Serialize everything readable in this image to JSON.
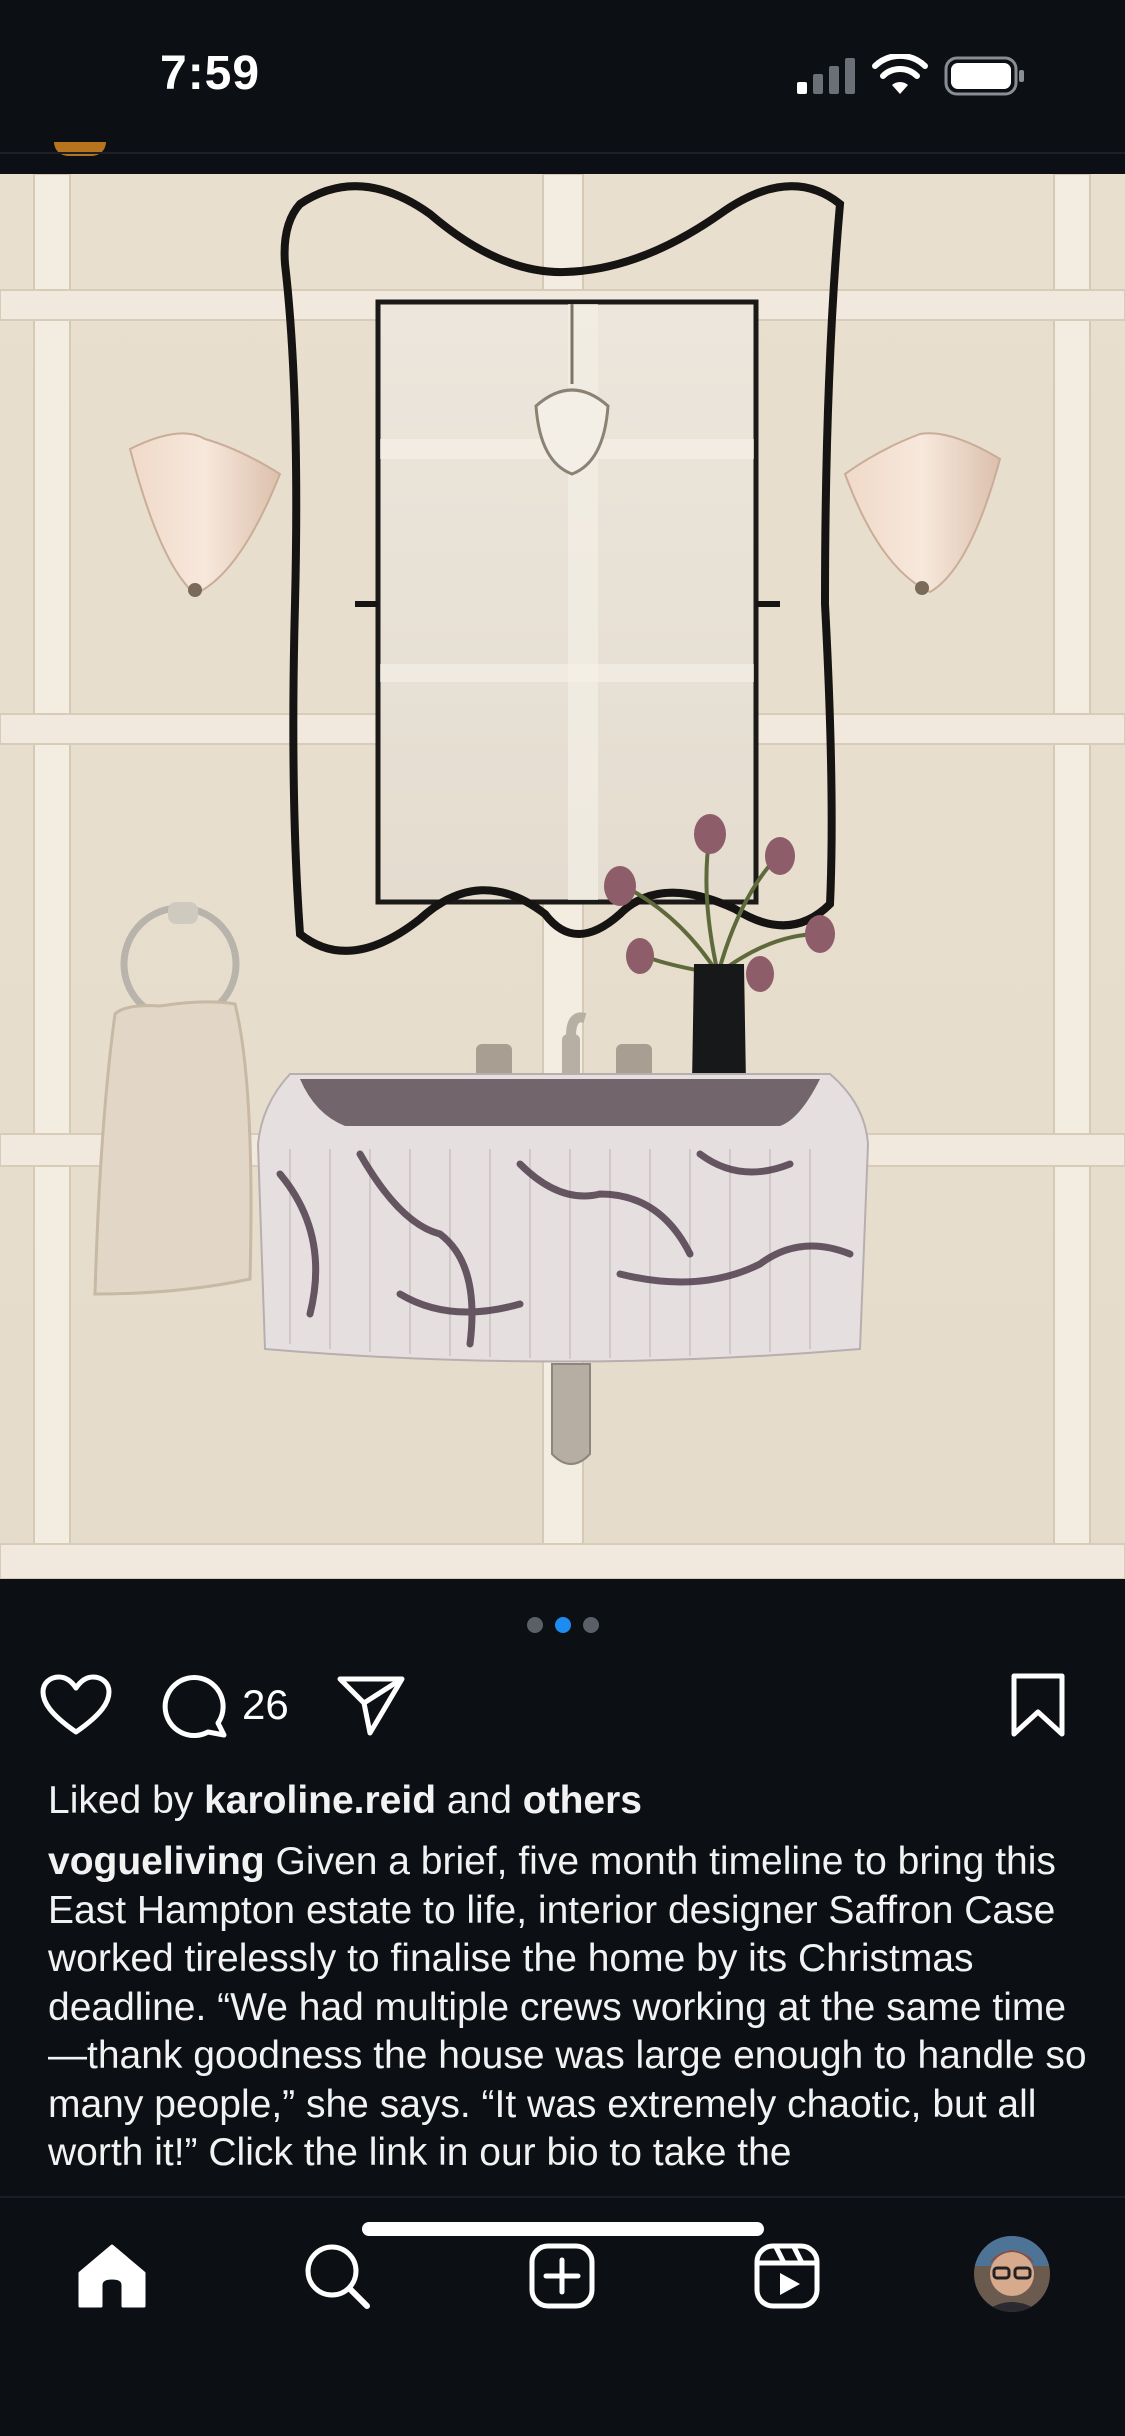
{
  "status_bar": {
    "time": "7:59",
    "signal_icon": "cellular-signal-icon",
    "wifi_icon": "wifi-icon",
    "battery_icon": "battery-icon"
  },
  "post": {
    "image_alt_icon": "bathroom-photo",
    "carousel": {
      "count": 3,
      "active_index": 1
    },
    "actions": {
      "like_icon": "heart-icon",
      "comment_icon": "comment-bubble-icon",
      "comment_count": "26",
      "share_icon": "paper-plane-icon",
      "save_icon": "bookmark-icon"
    },
    "liked_by": {
      "prefix": "Liked by ",
      "user": "karoline.reid",
      "middle": " and ",
      "others": "others"
    },
    "caption": {
      "username": "vogueliving",
      "text": " Given a brief, five month timeline to bring this East Hampton estate to life, interior designer Saffron Case worked tirelessly to finalise the home by its Christmas deadline. “We had multiple crews working at the same time—thank goodness the house was large enough to handle so many people,” she says. “It was extremely chaotic, but all worth it!” Click the link in our bio to take the"
    }
  },
  "bottom_nav": {
    "items": [
      {
        "icon": "home-icon",
        "active": true
      },
      {
        "icon": "search-icon"
      },
      {
        "icon": "create-post-icon"
      },
      {
        "icon": "reels-icon"
      },
      {
        "icon": "profile-avatar"
      }
    ]
  },
  "colors": {
    "background": "#0c0f14",
    "text": "#f5f5f5",
    "active_dot": "#1d8cf0",
    "inactive_dot": "#5a5f68"
  }
}
